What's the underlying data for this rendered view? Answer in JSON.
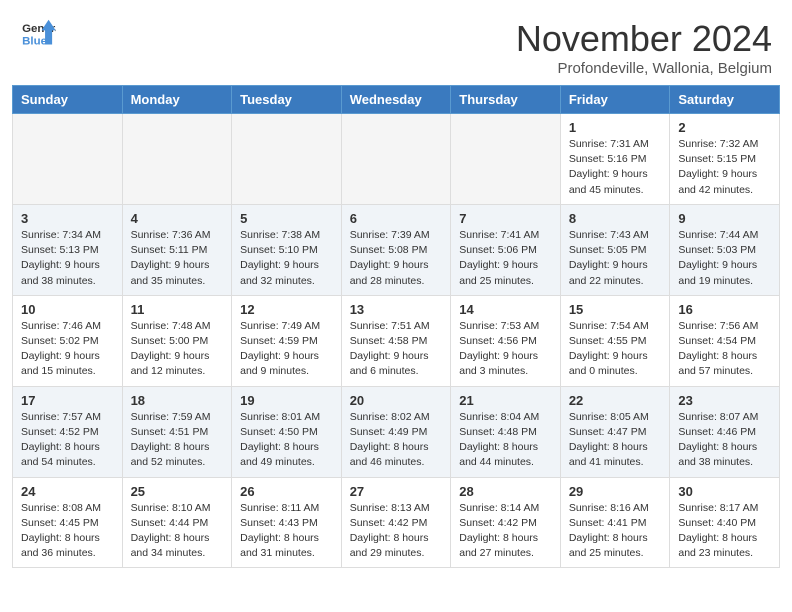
{
  "header": {
    "logo_line1": "General",
    "logo_line2": "Blue",
    "month": "November 2024",
    "location": "Profondeville, Wallonia, Belgium"
  },
  "days_of_week": [
    "Sunday",
    "Monday",
    "Tuesday",
    "Wednesday",
    "Thursday",
    "Friday",
    "Saturday"
  ],
  "weeks": [
    [
      {
        "day": "",
        "empty": true
      },
      {
        "day": "",
        "empty": true
      },
      {
        "day": "",
        "empty": true
      },
      {
        "day": "",
        "empty": true
      },
      {
        "day": "",
        "empty": true
      },
      {
        "day": "1",
        "sunrise": "7:31 AM",
        "sunset": "5:16 PM",
        "daylight": "9 hours and 45 minutes."
      },
      {
        "day": "2",
        "sunrise": "7:32 AM",
        "sunset": "5:15 PM",
        "daylight": "9 hours and 42 minutes."
      }
    ],
    [
      {
        "day": "3",
        "sunrise": "7:34 AM",
        "sunset": "5:13 PM",
        "daylight": "9 hours and 38 minutes."
      },
      {
        "day": "4",
        "sunrise": "7:36 AM",
        "sunset": "5:11 PM",
        "daylight": "9 hours and 35 minutes."
      },
      {
        "day": "5",
        "sunrise": "7:38 AM",
        "sunset": "5:10 PM",
        "daylight": "9 hours and 32 minutes."
      },
      {
        "day": "6",
        "sunrise": "7:39 AM",
        "sunset": "5:08 PM",
        "daylight": "9 hours and 28 minutes."
      },
      {
        "day": "7",
        "sunrise": "7:41 AM",
        "sunset": "5:06 PM",
        "daylight": "9 hours and 25 minutes."
      },
      {
        "day": "8",
        "sunrise": "7:43 AM",
        "sunset": "5:05 PM",
        "daylight": "9 hours and 22 minutes."
      },
      {
        "day": "9",
        "sunrise": "7:44 AM",
        "sunset": "5:03 PM",
        "daylight": "9 hours and 19 minutes."
      }
    ],
    [
      {
        "day": "10",
        "sunrise": "7:46 AM",
        "sunset": "5:02 PM",
        "daylight": "9 hours and 15 minutes."
      },
      {
        "day": "11",
        "sunrise": "7:48 AM",
        "sunset": "5:00 PM",
        "daylight": "9 hours and 12 minutes."
      },
      {
        "day": "12",
        "sunrise": "7:49 AM",
        "sunset": "4:59 PM",
        "daylight": "9 hours and 9 minutes."
      },
      {
        "day": "13",
        "sunrise": "7:51 AM",
        "sunset": "4:58 PM",
        "daylight": "9 hours and 6 minutes."
      },
      {
        "day": "14",
        "sunrise": "7:53 AM",
        "sunset": "4:56 PM",
        "daylight": "9 hours and 3 minutes."
      },
      {
        "day": "15",
        "sunrise": "7:54 AM",
        "sunset": "4:55 PM",
        "daylight": "9 hours and 0 minutes."
      },
      {
        "day": "16",
        "sunrise": "7:56 AM",
        "sunset": "4:54 PM",
        "daylight": "8 hours and 57 minutes."
      }
    ],
    [
      {
        "day": "17",
        "sunrise": "7:57 AM",
        "sunset": "4:52 PM",
        "daylight": "8 hours and 54 minutes."
      },
      {
        "day": "18",
        "sunrise": "7:59 AM",
        "sunset": "4:51 PM",
        "daylight": "8 hours and 52 minutes."
      },
      {
        "day": "19",
        "sunrise": "8:01 AM",
        "sunset": "4:50 PM",
        "daylight": "8 hours and 49 minutes."
      },
      {
        "day": "20",
        "sunrise": "8:02 AM",
        "sunset": "4:49 PM",
        "daylight": "8 hours and 46 minutes."
      },
      {
        "day": "21",
        "sunrise": "8:04 AM",
        "sunset": "4:48 PM",
        "daylight": "8 hours and 44 minutes."
      },
      {
        "day": "22",
        "sunrise": "8:05 AM",
        "sunset": "4:47 PM",
        "daylight": "8 hours and 41 minutes."
      },
      {
        "day": "23",
        "sunrise": "8:07 AM",
        "sunset": "4:46 PM",
        "daylight": "8 hours and 38 minutes."
      }
    ],
    [
      {
        "day": "24",
        "sunrise": "8:08 AM",
        "sunset": "4:45 PM",
        "daylight": "8 hours and 36 minutes."
      },
      {
        "day": "25",
        "sunrise": "8:10 AM",
        "sunset": "4:44 PM",
        "daylight": "8 hours and 34 minutes."
      },
      {
        "day": "26",
        "sunrise": "8:11 AM",
        "sunset": "4:43 PM",
        "daylight": "8 hours and 31 minutes."
      },
      {
        "day": "27",
        "sunrise": "8:13 AM",
        "sunset": "4:42 PM",
        "daylight": "8 hours and 29 minutes."
      },
      {
        "day": "28",
        "sunrise": "8:14 AM",
        "sunset": "4:42 PM",
        "daylight": "8 hours and 27 minutes."
      },
      {
        "day": "29",
        "sunrise": "8:16 AM",
        "sunset": "4:41 PM",
        "daylight": "8 hours and 25 minutes."
      },
      {
        "day": "30",
        "sunrise": "8:17 AM",
        "sunset": "4:40 PM",
        "daylight": "8 hours and 23 minutes."
      }
    ]
  ]
}
